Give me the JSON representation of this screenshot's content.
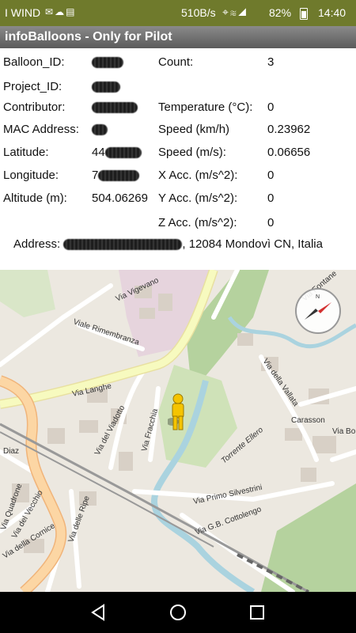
{
  "status_bar": {
    "carrier": "I WIND",
    "left_icons": [
      "mail-icon",
      "cloud-icon",
      "storage-icon"
    ],
    "network_speed": "510B/s",
    "right_icons": [
      "location-icon",
      "wifi-icon",
      "signal-icon"
    ],
    "battery": "82%",
    "time": "14:40",
    "bar_color": "#6f7a2c"
  },
  "title_bar": {
    "title": "infoBalloons - Only for Pilot"
  },
  "info": {
    "balloon_id_label": "Balloon_ID:",
    "project_id_label": "Project_ID:",
    "contributor_label": "Contributor:",
    "mac_label": "MAC Address:",
    "latitude_label": "Latitude:",
    "latitude_prefix": "44",
    "longitude_label": "Longitude:",
    "longitude_prefix": "7",
    "altitude_label": "Altitude (m):",
    "altitude_value": "504.06269",
    "count_label": "Count:",
    "count_value": "3",
    "temperature_label": "Temperature (°C):",
    "temperature_value": "0",
    "speed_kmh_label": "Speed (km/h)",
    "speed_kmh_value": "0.23962",
    "speed_ms_label": "Speed (m/s):",
    "speed_ms_value": "0.06656",
    "x_acc_label": "X Acc. (m/s^2):",
    "x_acc_value": "0",
    "y_acc_label": "Y Acc. (m/s^2):",
    "y_acc_value": "0",
    "z_acc_label": "Z Acc. (m/s^2):",
    "z_acc_value": "0",
    "address_label": "Address:",
    "address_suffix": ", 12084 Mondovì CN, Italia"
  },
  "map": {
    "labels": {
      "via_langhe": "Via Langhe",
      "viale_rimembranza": "Viale Rimembranza",
      "via_vigevano": "Via Vigevano",
      "via_fontane": "Via Fontane",
      "via_della_vallata": "Via della Vallata",
      "carassone": "Carasson",
      "via_bo": "Via Bo",
      "via_del_viadotto": "Via del Viadotto",
      "via_fracchia": "Via Fracchia",
      "torrente_ellero": "Torrente Ellero",
      "via_primo_silvestrini": "Via Primo Silvestrini",
      "via_cottolengo": "Via G.B. Cottolengo",
      "via_diaz": "Diaz",
      "via_quadrone": "Via Quadrone",
      "via_del_vecchio": "Via del Vecchio",
      "via_delle_ripe": "Via delle Ripe",
      "via_della_cornice": "Via della Cornice"
    },
    "colors": {
      "water": "#aad3df",
      "park": "#b5d29e",
      "main_road": "#f7fabf",
      "primary_road": "#fcd6a4",
      "railway": "#999999"
    }
  },
  "nav_bar": {
    "icons": [
      "back-icon",
      "home-icon",
      "recents-icon"
    ]
  }
}
